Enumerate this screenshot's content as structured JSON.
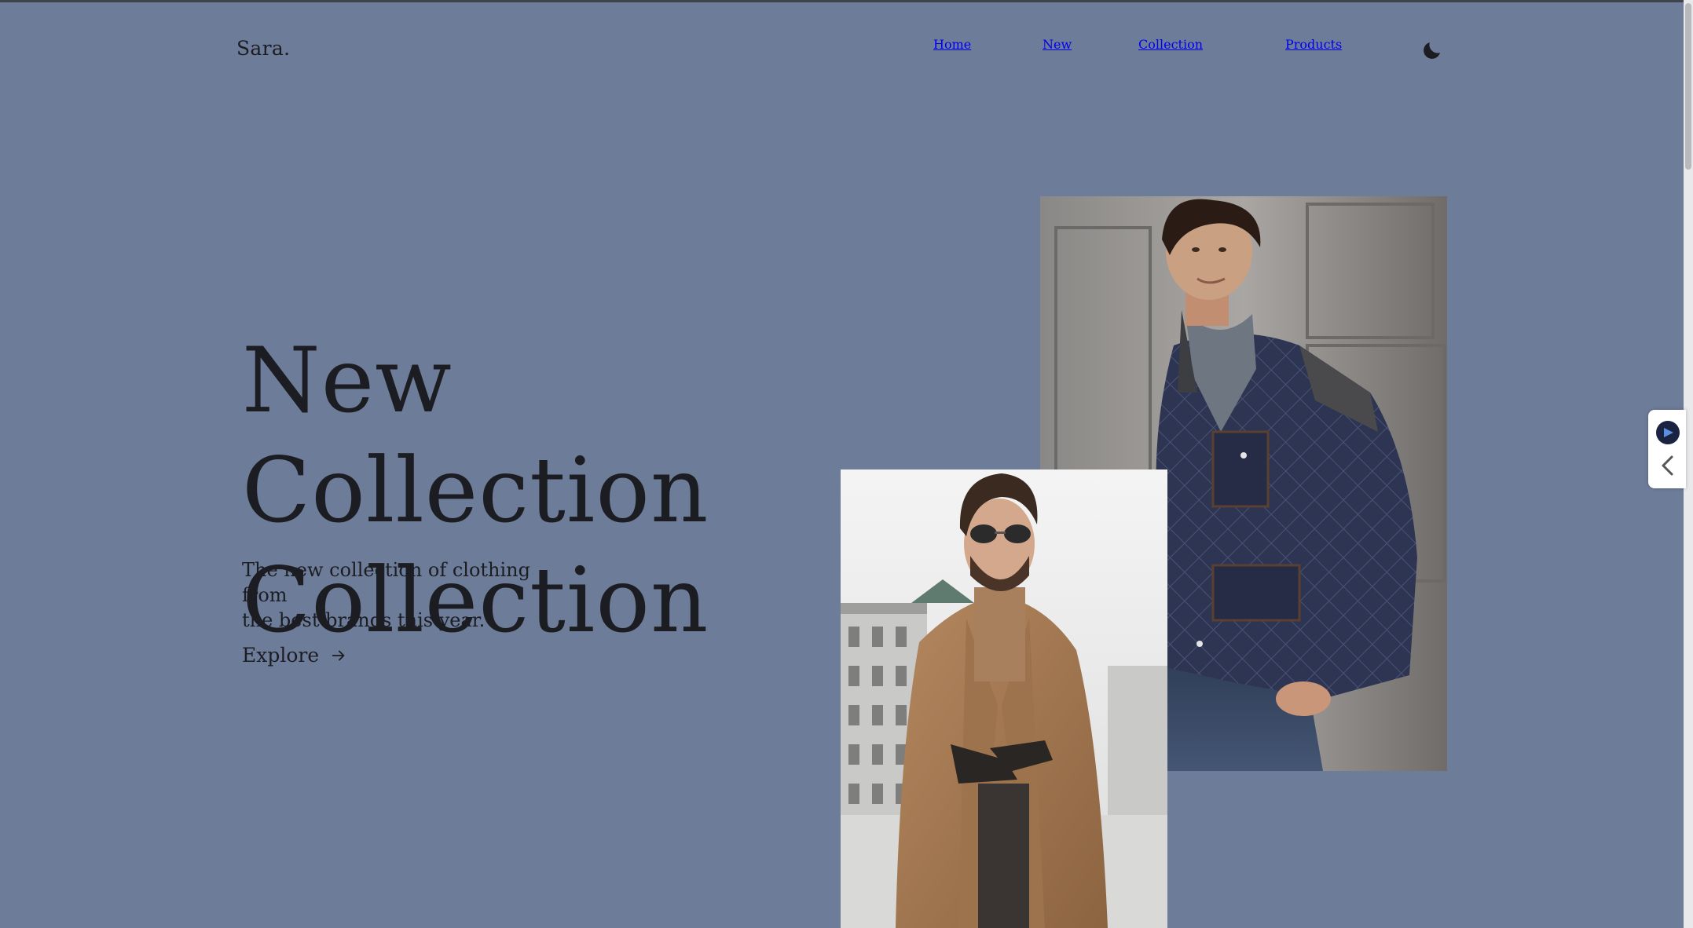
{
  "brand": {
    "logo": "Sara."
  },
  "nav": {
    "items": [
      {
        "label": "Home",
        "active": true
      },
      {
        "label": "New",
        "active": false
      },
      {
        "label": "Collection",
        "active": false
      },
      {
        "label": "Products",
        "active": false
      }
    ],
    "theme_toggle_icon": "moon-icon"
  },
  "hero": {
    "title_line1": "New Collection",
    "title_line2": "Collection",
    "description_line1": "The new collection of clothing from",
    "description_line2": "the best brands this year.",
    "cta_label": "Explore",
    "cta_icon": "arrow-right-icon"
  },
  "images": {
    "big": "man-in-navy-quilted-jacket",
    "small": "man-in-camel-coat-with-sunglasses"
  },
  "side_widget": {
    "icons": [
      "assistant-icon",
      "chevron-left-icon"
    ]
  },
  "colors": {
    "background": "#6d7c98",
    "text": "#1c1d22"
  }
}
